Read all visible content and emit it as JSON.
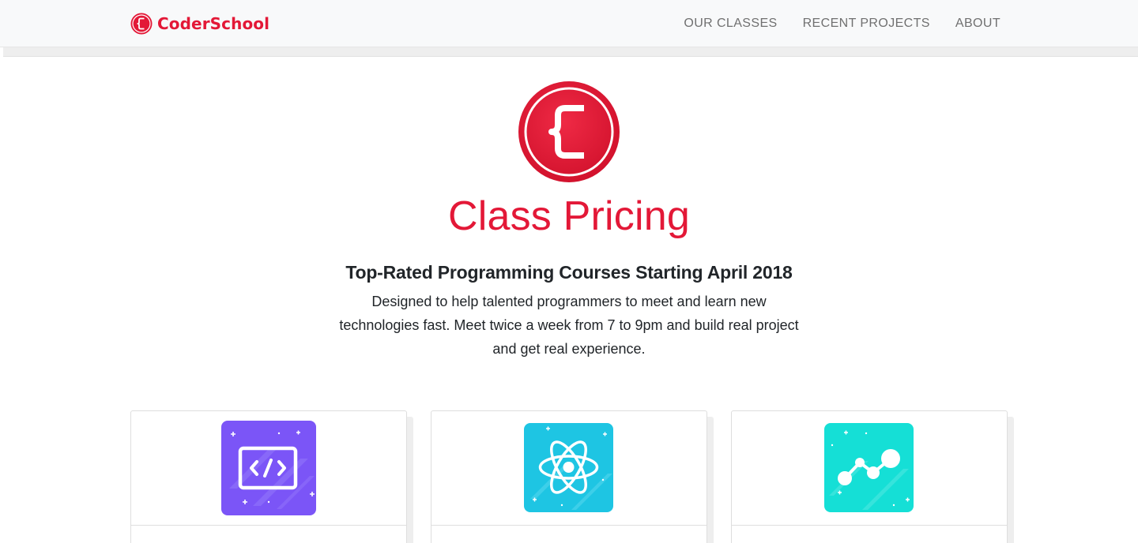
{
  "navbar": {
    "brand_name": "CoderSchool",
    "links": [
      "OUR CLASSES",
      "RECENT PROJECTS",
      "ABOUT"
    ]
  },
  "hero": {
    "title": "Class Pricing",
    "subtitle": "Top-Rated Programming Courses Starting April 2018",
    "description": "Designed to help talented programmers to meet and learn new technologies fast. Meet twice a week from 7 to 9pm and build real project and get real experience."
  },
  "cards": [
    {
      "icon": "code-icon",
      "color": "#7b55f7"
    },
    {
      "icon": "react-atom-icon",
      "color": "#1ec5e3"
    },
    {
      "icon": "data-graph-icon",
      "color": "#15dfd6"
    }
  ],
  "colors": {
    "brand": "#e31837",
    "navbar_bg": "#f8f9fa",
    "nav_link": "#707070",
    "text": "#212529"
  }
}
